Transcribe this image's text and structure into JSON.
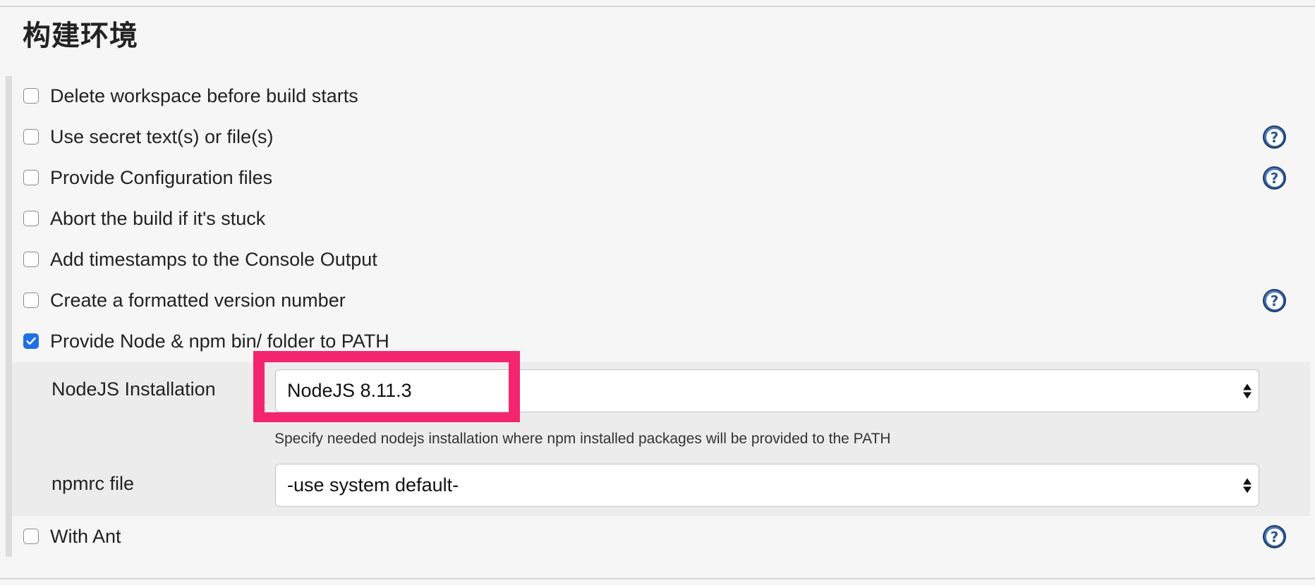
{
  "section": {
    "title": "构建环境"
  },
  "options": [
    {
      "label": "Delete workspace before build starts",
      "checked": false,
      "help": false
    },
    {
      "label": "Use secret text(s) or file(s)",
      "checked": false,
      "help": true
    },
    {
      "label": "Provide Configuration files",
      "checked": false,
      "help": true
    },
    {
      "label": "Abort the build if it's stuck",
      "checked": false,
      "help": false
    },
    {
      "label": "Add timestamps to the Console Output",
      "checked": false,
      "help": false
    },
    {
      "label": "Create a formatted version number",
      "checked": false,
      "help": true
    },
    {
      "label": "Provide Node & npm bin/ folder to PATH",
      "checked": true,
      "help": false
    },
    {
      "label": "With Ant",
      "checked": false,
      "help": true
    }
  ],
  "node_settings": {
    "installation_label": "NodeJS Installation",
    "installation_value": "NodeJS 8.11.3",
    "installation_help": "Specify needed nodejs installation where npm installed packages will be provided to the PATH",
    "npmrc_label": "npmrc file",
    "npmrc_value": "-use system default-"
  },
  "icons": {
    "help": "help-question-icon",
    "select": "select-updown-arrows-icon",
    "check": "checkmark-icon"
  },
  "colors": {
    "checkbox_checked": "#1f6fe5",
    "help_icon": "#3c66a6",
    "annotation_highlight": "#f4256f",
    "background": "#f6f6f6",
    "nested_panel": "#ececec"
  }
}
